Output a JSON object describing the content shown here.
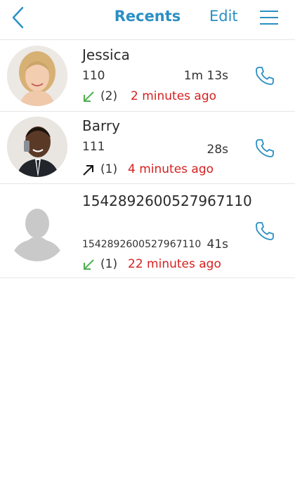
{
  "header": {
    "title": "Recents",
    "edit_label": "Edit",
    "back_icon": "chevron-left-icon",
    "menu_icon": "hamburger-menu-icon",
    "accent_color": "#2a8fc3"
  },
  "calls": [
    {
      "name": "Jessica",
      "number": "110",
      "duration": "1m 13s",
      "direction": "incoming",
      "count": "(2)",
      "time_ago": "2 minutes ago"
    },
    {
      "name": "Barry",
      "number": "111",
      "duration": "28s",
      "direction": "outgoing",
      "count": "(1)",
      "time_ago": "4 minutes ago"
    },
    {
      "name": "1542892600527967110",
      "number": "1542892600527967110",
      "duration": "41s",
      "direction": "incoming",
      "count": "(1)",
      "time_ago": "22 minutes ago"
    }
  ],
  "colors": {
    "incoming": "#4caf50",
    "outgoing": "#111111",
    "time_ago": "#d62020"
  }
}
